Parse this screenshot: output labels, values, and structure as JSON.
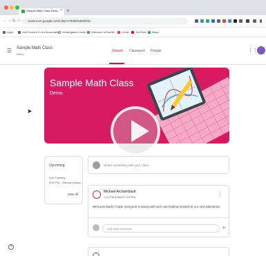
{
  "browser": {
    "tab_title": "Sample Math Class Demo",
    "tab_close": "×",
    "new_tab": "+",
    "url": "classroom.google.com/c/MjYxTEMOUDMOfw",
    "nav": {
      "back": "←",
      "forward": "→",
      "reload": "↻",
      "home": "⌂"
    },
    "bookmarks": [
      "Apps",
      "Jedi Horse'd 5 of a Bookmarks",
      "Kindergarten Learn...",
      "Welcome to BurNit...",
      "Gmail",
      "YouTube",
      "Maps"
    ]
  },
  "header": {
    "menu_icon": "☰",
    "class_name": "Sample Math Class",
    "class_section": "Demo",
    "tabs": [
      "Stream",
      "Classwork",
      "People"
    ],
    "apps_icon": "⋮⋮"
  },
  "banner": {
    "title": "Sample Math Class",
    "section": "Demo",
    "color": "#d81b60"
  },
  "upcoming": {
    "title": "Upcoming",
    "due": "Due Tuesday",
    "item": "8:59 PM – Sample Assign...",
    "view_all": "View all"
  },
  "share": {
    "placeholder": "Share something with your class..."
  },
  "post": {
    "author": "Michael Archambault",
    "time": "1:14 PM (Edited 1:26 PM)",
    "body": "Welcome back! I hope everyone is doing well and I am looking forward to our new adventure.",
    "more": "⋮",
    "comment_placeholder": "Add class comment...",
    "send": "➤"
  },
  "help": "?"
}
